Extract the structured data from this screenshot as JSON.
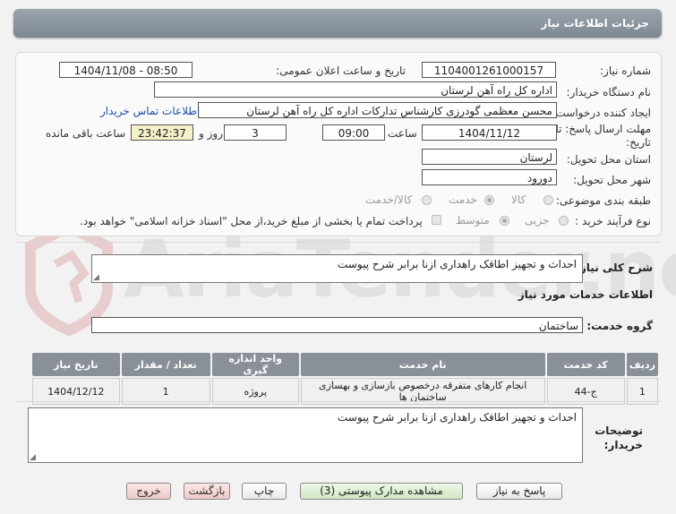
{
  "header": {
    "title": "جزئيات اطلاعات نياز"
  },
  "need_number": {
    "label": "شماره نیاز:",
    "value": "1104001261000157"
  },
  "announce_datetime": {
    "label": "تاریخ و ساعت اعلان عمومی:",
    "value": "1404/11/08 - 08:50"
  },
  "buyer_org": {
    "label": "نام دستگاه خریدار:",
    "value": "اداره کل راه آهن لرستان"
  },
  "requester": {
    "label": "ایجاد کننده درخواست:",
    "value": "محسن معظمی گودرزی کارشناس تدارکات اداره کل راه آهن لرستان",
    "contact_link": "اطلاعات تماس خریدار"
  },
  "deadline": {
    "label_line1": "مهلت ارسال پاسخ: تا",
    "label_line2": "تاریخ:",
    "date": "1404/11/12",
    "time_label": "ساعت",
    "time": "09:00",
    "days": "3",
    "days_label": "روز و",
    "remaining": "23:42:37",
    "remaining_label": "ساعت باقی مانده"
  },
  "delivery_province": {
    "label": "استان محل تحویل:",
    "value": "لرستان"
  },
  "delivery_city": {
    "label": "شهر محل تحویل:",
    "value": "دورود"
  },
  "category": {
    "label": "طبقه بندی موضوعی:",
    "options": [
      "کالا",
      "خدمت",
      "کالا/خدمت"
    ],
    "selected": "خدمت"
  },
  "process_type": {
    "label": "نوع فرآیند خرید :",
    "options": [
      "جزیی",
      "متوسط"
    ],
    "selected": "متوسط",
    "payment_note": "پرداخت تمام یا بخشی از مبلغ خرید،از محل \"اسناد خزانه اسلامی\" خواهد بود."
  },
  "general_description": {
    "label": "شرح کلی نیاز:",
    "value": "احداث و تجهیز اطاقک راهداری ازنا برابر شرح پیوست"
  },
  "services_section": {
    "title": "اطلاعات خدمات مورد نیاز"
  },
  "service_group": {
    "label": "گروه خدمت:",
    "value": "ساختمان"
  },
  "table": {
    "headers": [
      "ردیف",
      "کد خدمت",
      "نام خدمت",
      "واحد اندازه گیری",
      "تعداد / مقدار",
      "تاریخ نیاز"
    ],
    "rows": [
      [
        "1",
        "ج-44",
        "انجام کارهای متفرقه درخصوص بازسازی و بهسازی ساختمان ها",
        "پروژه",
        "1",
        "1404/12/12"
      ]
    ]
  },
  "buyer_notes": {
    "label_line1": "توضیحات",
    "label_line2": "خریدار:",
    "value": "احداث و تجهیز اطاقک راهداری ازنا برابر شرح پیوست"
  },
  "buttons": {
    "reply": "پاسخ به نیاز",
    "attachments": "مشاهده مدارک پیوستی (3)",
    "print": "چاپ",
    "back": "بازگشت",
    "exit": "خروج"
  },
  "watermark": {
    "text": "AriaTender.neT"
  },
  "colors": {
    "header_bg": "#8a949e",
    "link": "#1a4fb5",
    "remaining_bg": "#f3f1c8",
    "logo": "#d9a0a0"
  }
}
